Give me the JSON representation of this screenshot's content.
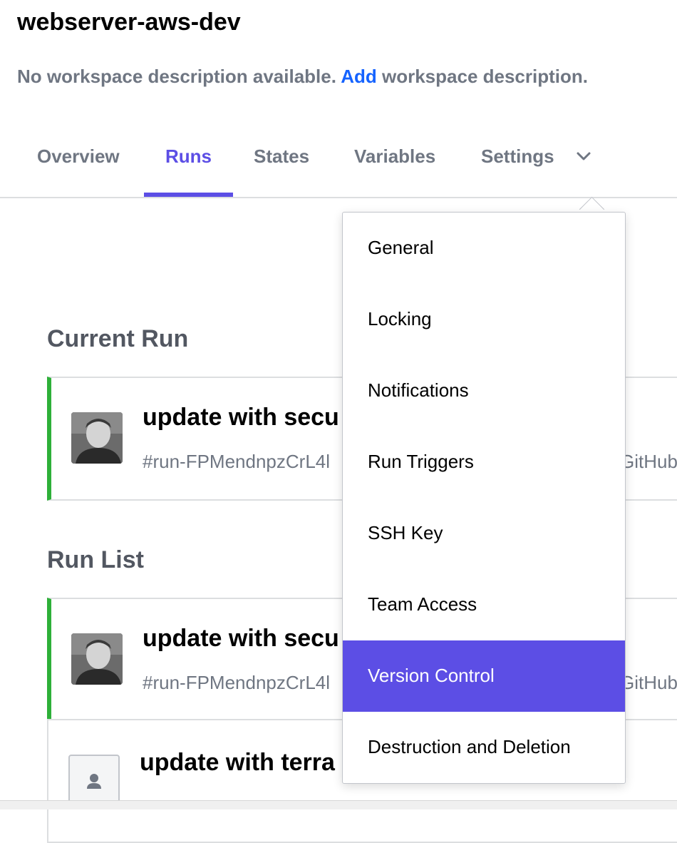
{
  "workspace": {
    "title": "webserver-aws-dev",
    "description": "No workspace description available.",
    "add_link": "Add",
    "description_suffix": "workspace description."
  },
  "tabs": [
    {
      "label": "Overview",
      "active": false
    },
    {
      "label": "Runs",
      "active": true
    },
    {
      "label": "States",
      "active": false
    },
    {
      "label": "Variables",
      "active": false
    },
    {
      "label": "Settings",
      "active": false
    }
  ],
  "current_run": {
    "heading": "Current Run",
    "title": "update with secu",
    "id": "#run-FPMendnpzCrL4l",
    "trigger": "GitHub"
  },
  "run_list": {
    "heading": "Run List",
    "items": [
      {
        "title": "update with secu",
        "id": "#run-FPMendnpzCrL4l",
        "trigger": "GitHub",
        "status_color": "#2eb039"
      },
      {
        "title": "update with terra",
        "id": "",
        "trigger": "",
        "status_color": ""
      }
    ]
  },
  "settings_menu": {
    "items": [
      {
        "label": "General",
        "selected": false
      },
      {
        "label": "Locking",
        "selected": false
      },
      {
        "label": "Notifications",
        "selected": false
      },
      {
        "label": "Run Triggers",
        "selected": false
      },
      {
        "label": "SSH Key",
        "selected": false
      },
      {
        "label": "Team Access",
        "selected": false
      },
      {
        "label": "Version Control",
        "selected": true
      },
      {
        "label": "Destruction and Deletion",
        "selected": false
      }
    ]
  },
  "colors": {
    "accent": "#5c4ee5",
    "link": "#1563ff",
    "success": "#2eb039",
    "muted_text": "#6f7682"
  },
  "icons": [
    "chevron-down-icon",
    "user-avatar-photo",
    "generic-user-icon"
  ]
}
